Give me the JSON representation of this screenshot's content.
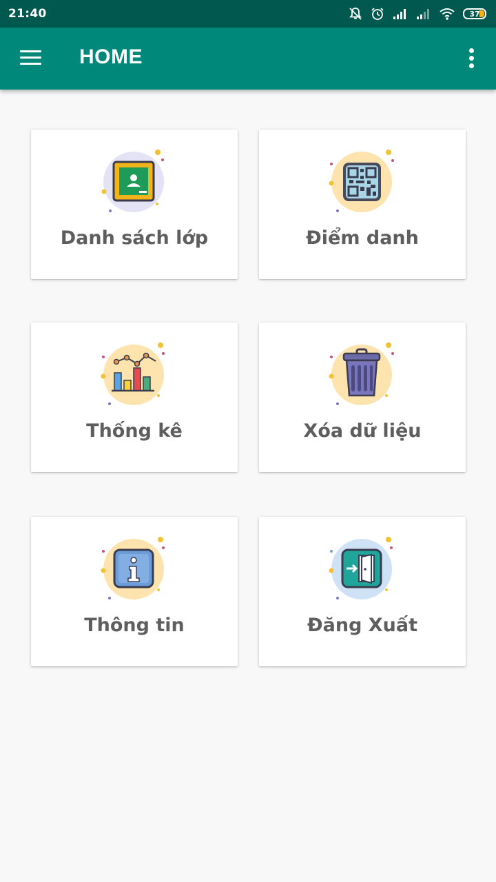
{
  "status_bar": {
    "time": "21:40",
    "battery_level": "37",
    "icons": [
      "notifications-off-icon",
      "alarm-icon",
      "signal-icon",
      "signal-weak-icon",
      "wifi-icon",
      "battery-icon"
    ]
  },
  "app_bar": {
    "title": "HOME",
    "menu_icon": "hamburger-menu-icon",
    "overflow_icon": "more-vert-icon",
    "color": "#00897b",
    "status_color": "#00584f"
  },
  "menu": [
    {
      "label": "Danh sách lớp",
      "icon": "classroom-board-icon"
    },
    {
      "label": "Điểm danh",
      "icon": "qr-code-icon"
    },
    {
      "label": "Thống kê",
      "icon": "bar-chart-icon"
    },
    {
      "label": "Xóa dữ liệu",
      "icon": "trash-bin-icon"
    },
    {
      "label": "Thông tin",
      "icon": "info-icon"
    },
    {
      "label": "Đăng Xuất",
      "icon": "logout-door-icon"
    }
  ]
}
